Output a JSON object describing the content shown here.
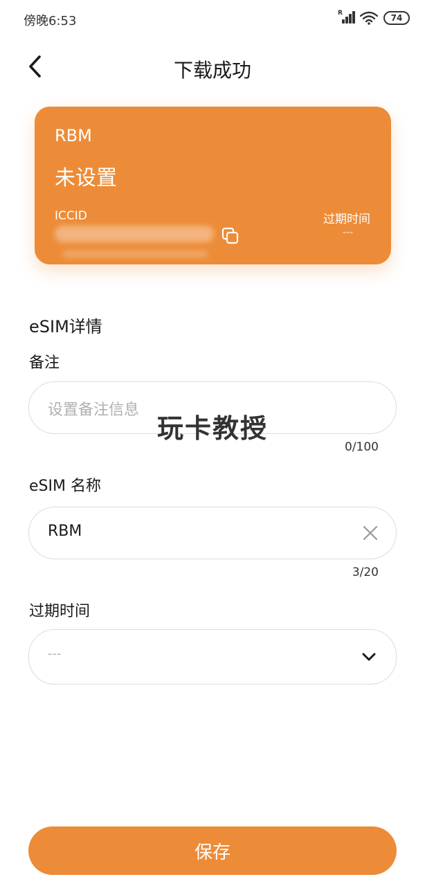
{
  "status_bar": {
    "time": "傍晚6:53",
    "battery": "74",
    "signal_icon": "signal-icon",
    "wifi_icon": "wifi-icon"
  },
  "header": {
    "title": "下载成功",
    "back_icon": "back-arrow-icon"
  },
  "card": {
    "carrier": "RBM",
    "status": "未设置",
    "iccid_label": "ICCID",
    "expiry_label": "过期时间",
    "expiry_value": "---",
    "background_color": "#ed8c38"
  },
  "details": {
    "section_title": "eSIM详情",
    "note": {
      "label": "备注",
      "placeholder": "设置备注信息",
      "value": "",
      "counter": "0/100"
    },
    "name": {
      "label": "eSIM 名称",
      "value": "RBM",
      "counter": "3/20"
    },
    "expiry": {
      "label": "过期时间",
      "value": "---"
    }
  },
  "watermark": "玩卡教授",
  "save_button": {
    "label": "保存",
    "color": "#ed8c38"
  }
}
